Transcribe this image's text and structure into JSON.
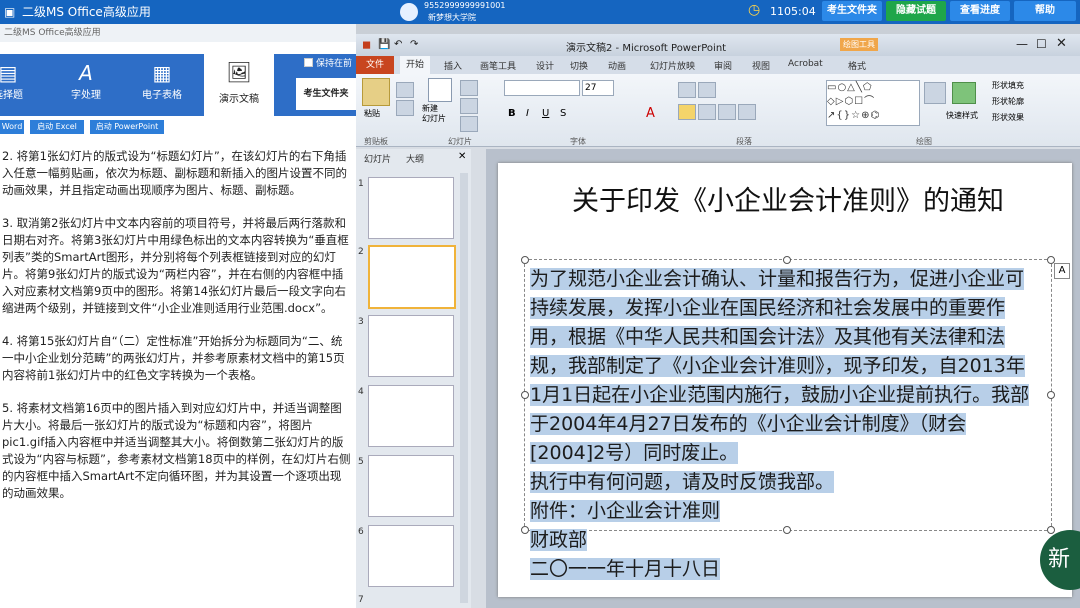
{
  "topbar": {
    "title": "二级MS Office高级应用",
    "examinee_id": "9552999999991001",
    "examinee_name": "新梦想大学院",
    "timer": "1105:04",
    "buttons": [
      "考生文件夹",
      "隐藏试题",
      "查看进度",
      "帮助"
    ]
  },
  "left": {
    "header": "二级MS Office高级应用",
    "tabs": [
      "选择题",
      "字处理",
      "电子表格",
      "演示文稿"
    ],
    "checkbox_label": "保持在前",
    "folder_label": "考生文件夹",
    "launch": [
      "Word",
      "启动 Excel",
      "启动 PowerPoint"
    ],
    "questions": [
      "2. 将第1张幻灯片的版式设为“标题幻灯片”，在该幻灯片的右下角插入任意一幅剪贴画，依次为标题、副标题和新插入的图片设置不同的动画效果，并且指定动画出现顺序为图片、标题、副标题。",
      "3. 取消第2张幻灯片中文本内容前的项目符号，并将最后两行落款和日期右对齐。将第3张幻灯片中用绿色标出的文本内容转换为“垂直框列表”类的SmartArt图形，并分别将每个列表框链接到对应的幻灯片。将第9张幻灯片的版式设为“两栏内容”，并在右侧的内容框中插入对应素材文档第9页中的图形。将第14张幻灯片最后一段文字向右缩进两个级别，并链接到文件“小企业准则适用行业范围.docx”。",
      "4. 将第15张幻灯片自“（二）定性标准”开始拆分为标题同为“二、统一中小企业划分范畴”的两张幻灯片，并参考原素材文档中的第15页内容将前1张幻灯片中的红色文字转换为一个表格。",
      "5. 将素材文档第16页中的图片插入到对应幻灯片中，并适当调整图片大小。将最后一张幻灯片的版式设为“标题和内容”，将图片pic1.gif插入内容框中并适当调整其大小。将倒数第二张幻灯片的版式设为“内容与标题”，参考素材文档第18页中的样例，在幻灯片右侧的内容框中插入SmartArt不定向循环图，并为其设置一个逐项出现的动画效果。"
    ]
  },
  "ppt": {
    "window_title": "演示文稿2 - Microsoft PowerPoint",
    "context_tab": "绘图工具",
    "ribbon_tabs": [
      "文件",
      "开始",
      "插入",
      "画笔工具",
      "设计",
      "切换",
      "动画",
      "幻灯片放映",
      "审阅",
      "视图",
      "Acrobat",
      "格式"
    ],
    "groups": [
      "剪贴板",
      "幻灯片",
      "字体",
      "段落",
      "绘图"
    ],
    "paste": "粘贴",
    "new_slide": "新建\n幻灯片",
    "font_size": "27",
    "quick_styles": "快速样式",
    "shape_fill": "形状填充",
    "shape_outline": "形状轮廓",
    "shape_effect": "形状效果",
    "panel_tabs": [
      "幻灯片",
      "大纲"
    ],
    "slide_numbers": [
      "1",
      "2",
      "3",
      "4",
      "5",
      "6",
      "7"
    ],
    "slide": {
      "title": "关于印发《小企业会计准则》的通知",
      "body": [
        "为了规范小企业会计确认、计量和报告行为，促进小企业可持续发展，发挥小企业在国民经济和社会发展中的重要作用，根据《中华人民共和国会计法》及其他有关法律和法规，我部制定了《小企业会计准则》，现予印发，自2013年1月1日起在小企业范围内施行，鼓励小企业提前执行。我部于2004年4月27日发布的《小企业会计制度》（财会[2004]2号）同时废止。",
        "执行中有何问题，请及时反馈我部。",
        "附件：小企业会计准则",
        "财政部",
        "二〇一一年十月十八日"
      ]
    }
  },
  "colors": {
    "accent_blue": "#1565c0",
    "exam_green": "#1fa64a",
    "selection": "#b8cfe8"
  }
}
